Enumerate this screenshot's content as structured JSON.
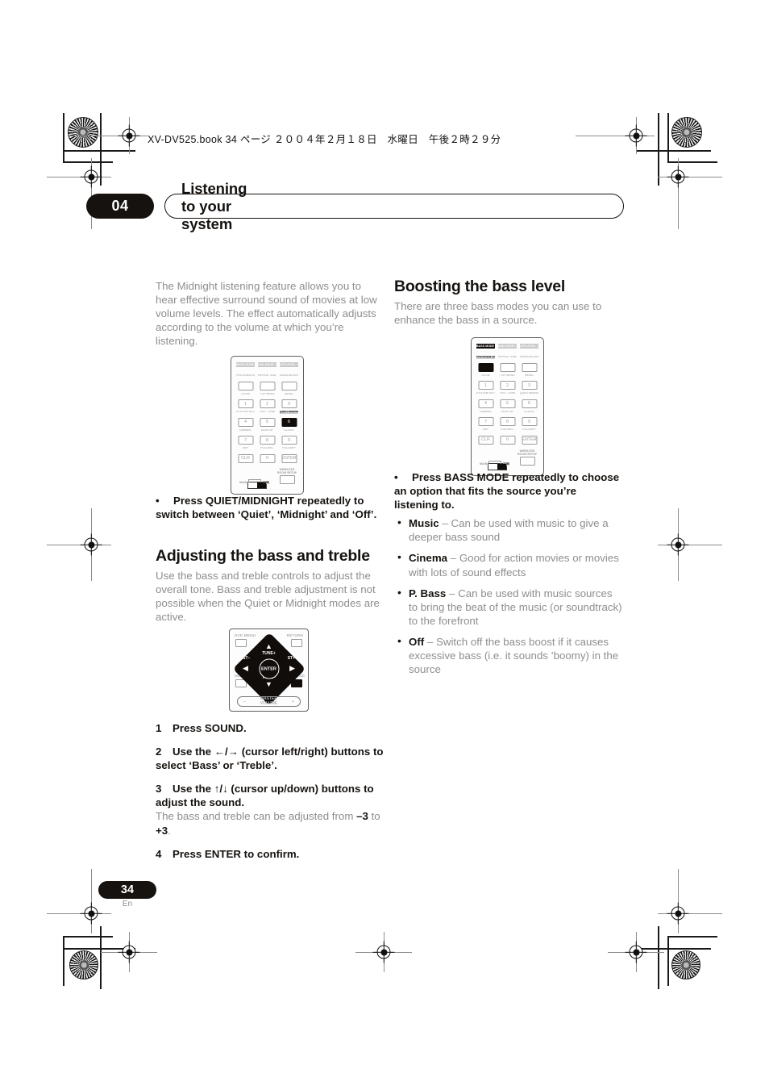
{
  "document": {
    "file_info_line": "XV-DV525.book  34 ページ  ２００４年２月１８日　水曜日　午後２時２９分",
    "chapter_number": "04",
    "chapter_title": "Listening to your system",
    "page_number": "34",
    "language_code": "En"
  },
  "left_column": {
    "intro_paragraph": "The Midnight listening feature allows you to hear effective surround sound of movies at low volume levels. The effect automatically adjusts according to the volume at which you’re listening.",
    "quiet_bullet": "Press QUIET/MIDNIGHT repeatedly to switch between ‘Quiet’, ‘Midnight’ and ‘Off’.",
    "section_heading": "Adjusting the bass and treble",
    "section_body": "Use the bass and treble controls to adjust the overall tone. Bass and treble adjustment is not possible when the Quiet or Midnight modes are active.",
    "steps": [
      {
        "num": "1",
        "text": "Press SOUND."
      },
      {
        "num": "2",
        "text": "Use the ←/→ (cursor left/right) buttons to select ‘Bass’ or ‘Treble’."
      },
      {
        "num": "3",
        "text": "Use the ↑/↓ (cursor up/down) buttons to adjust the sound."
      },
      {
        "num": "4",
        "text": "Press ENTER to confirm."
      }
    ],
    "step3_note_pre": "The bass and treble can be adjusted from ",
    "step3_note_min": "–3",
    "step3_note_mid": " to ",
    "step3_note_max": "+3",
    "step3_note_post": "."
  },
  "right_column": {
    "section_heading": "Boosting the bass level",
    "section_body": "There are three bass modes you can use to enhance the bass in a source.",
    "bass_bullet": "Press BASS MODE repeatedly to choose an option that fits the source you’re listening to.",
    "modes": [
      {
        "name": "Music",
        "desc": " – Can be used with music to give a deeper bass sound"
      },
      {
        "name": "Cinema",
        "desc": " – Good for action movies or movies with lots of sound effects"
      },
      {
        "name": "P. Bass",
        "desc": " – Can be used with music sources to bring the beat of the music (or soundtrack) to the forefront"
      },
      {
        "name": "Off",
        "desc": " – Switch off the bass boost if it causes excessive bass (i.e. it sounds ’boomy) in the source"
      }
    ]
  },
  "remote_quiet": {
    "caption": "remote-keypad-quiet-midnight",
    "header_row": [
      {
        "label": "BASS MODE / SURROUND",
        "highlighted": false
      },
      {
        "label": "DIALOGUE / ADVANCED",
        "highlighted": false
      },
      {
        "label": "LFE LEVEL / VIRTUAL SB",
        "highlighted": false
      }
    ],
    "keys": [
      {
        "label": "PROGRAM AUDIO",
        "key": "",
        "highlighted": false
      },
      {
        "label": "REPEAT SUBTITLE",
        "key": "",
        "highlighted": false
      },
      {
        "label": "RANDOM ANGLE",
        "key": "",
        "highlighted": false
      },
      {
        "label": "ZOOM",
        "key": "1",
        "highlighted": false
      },
      {
        "label": "TOP MENU",
        "key": "2",
        "highlighted": false
      },
      {
        "label": "MENU",
        "key": "3",
        "highlighted": false
      },
      {
        "label": "SYSTEM SETUP",
        "key": "4",
        "highlighted": false
      },
      {
        "label": "TEST TONE",
        "key": "5",
        "highlighted": false
      },
      {
        "label": "QUIET/MIDNIGHT",
        "key": "6",
        "highlighted": true
      },
      {
        "label": "DIMMER",
        "key": "7",
        "highlighted": false
      },
      {
        "label": "DISPLAY",
        "key": "8",
        "highlighted": false
      },
      {
        "label": "CLOCK",
        "key": "9",
        "highlighted": false
      },
      {
        "label": "SB+",
        "key": "CLR",
        "highlighted": false
      },
      {
        "label": "FOLDER–",
        "key": "0",
        "highlighted": false
      },
      {
        "label": "FOLDER+",
        "key": "ENTER",
        "highlighted": false
      }
    ],
    "main_label": "MAIN",
    "sub_label": "SUB",
    "wireless_label": "WIRELESS ROOM SETUP"
  },
  "remote_bass": {
    "caption": "remote-keypad-bass-mode",
    "header_row": [
      {
        "label": "BASS MODE / SURROUND",
        "highlighted": true
      },
      {
        "label": "DIALOGUE / ADVANCED",
        "highlighted": false
      },
      {
        "label": "LFE LEVEL / VIRTUAL SB",
        "highlighted": false
      }
    ],
    "keys": [
      {
        "label": "PROGRAM AUDIO",
        "key": "",
        "highlighted": true
      },
      {
        "label": "REPEAT SUBTITLE",
        "key": "",
        "highlighted": false
      },
      {
        "label": "RANDOM ANGLE",
        "key": "",
        "highlighted": false
      },
      {
        "label": "ZOOM",
        "key": "1",
        "highlighted": false
      },
      {
        "label": "TOP MENU",
        "key": "2",
        "highlighted": false
      },
      {
        "label": "MENU",
        "key": "3",
        "highlighted": false
      },
      {
        "label": "SYSTEM SETUP",
        "key": "4",
        "highlighted": false
      },
      {
        "label": "TEST TONE",
        "key": "5",
        "highlighted": false
      },
      {
        "label": "QUIET/MIDNIGHT",
        "key": "6",
        "highlighted": false
      },
      {
        "label": "DIMMER",
        "key": "7",
        "highlighted": false
      },
      {
        "label": "DISPLAY",
        "key": "8",
        "highlighted": false
      },
      {
        "label": "CLOCK",
        "key": "9",
        "highlighted": false
      },
      {
        "label": "SB+",
        "key": "CLR",
        "highlighted": false
      },
      {
        "label": "FOLDER–",
        "key": "0",
        "highlighted": false
      },
      {
        "label": "FOLDER+",
        "key": "ENTER",
        "highlighted": false
      }
    ],
    "main_label": "MAIN",
    "sub_label": "SUB",
    "wireless_label": "WIRELESS ROOM SETUP"
  },
  "cursor_pad": {
    "caption": "remote-cursor-pad",
    "dvd_menu": "DVD MENU",
    "return": "RETURN",
    "mute": "MUTE",
    "sound": "SOUND",
    "up": "TUNE+",
    "down": "TUNE–",
    "left": "ST–",
    "right": "ST+",
    "enter": "ENTER",
    "volume_line1": "MASTER",
    "volume_line2": "VOLUME",
    "volume_minus": "–",
    "volume_plus": "+"
  }
}
